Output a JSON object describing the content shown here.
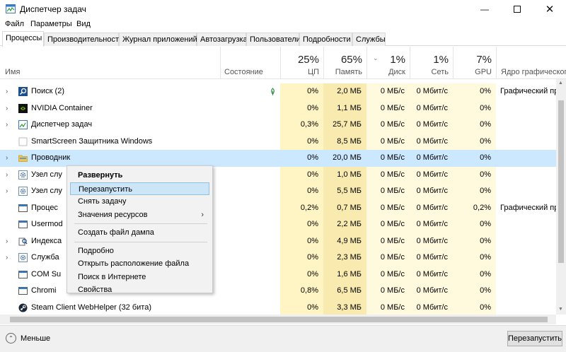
{
  "window": {
    "title": "Диспетчер задач",
    "min_icon": "minimize-icon",
    "max_icon": "maximize-icon",
    "close_icon": "close-icon"
  },
  "menu": [
    "Файл",
    "Параметры",
    "Вид"
  ],
  "tabs": [
    "Процессы",
    "Производительность",
    "Журнал приложений",
    "Автозагрузка",
    "Пользователи",
    "Подробности",
    "Службы"
  ],
  "active_tab": "Процессы",
  "columns": {
    "name": "Имя",
    "status": "Состояние",
    "cpu": {
      "pct": "25%",
      "label": "ЦП"
    },
    "mem": {
      "pct": "65%",
      "label": "Память"
    },
    "disk": {
      "pct": "1%",
      "label": "Диск"
    },
    "net": {
      "pct": "1%",
      "label": "Сеть"
    },
    "gpu": {
      "pct": "7%",
      "label": "GPU"
    },
    "gpu_engine": "Ядро графического"
  },
  "rows": [
    {
      "name": "Поиск (2)",
      "expand": true,
      "icon": "search-app-icon",
      "status_icon": "leaf-icon",
      "cpu": "0%",
      "mem": "2,0 МБ",
      "disk": "0 МБ/с",
      "net": "0 Мбит/с",
      "gpu": "0%",
      "gpu_engine": "Графический про"
    },
    {
      "name": "NVIDIA Container",
      "expand": true,
      "icon": "nvidia-icon",
      "cpu": "0%",
      "mem": "1,1 МБ",
      "disk": "0 МБ/с",
      "net": "0 Мбит/с",
      "gpu": "0%",
      "gpu_engine": ""
    },
    {
      "name": "Диспетчер задач",
      "expand": true,
      "icon": "task-manager-icon",
      "cpu": "0,3%",
      "mem": "25,7 МБ",
      "disk": "0 МБ/с",
      "net": "0 Мбит/с",
      "gpu": "0%",
      "gpu_engine": ""
    },
    {
      "name": "SmartScreen Защитника Windows",
      "expand": false,
      "icon": "smartscreen-icon",
      "cpu": "0%",
      "mem": "8,5 МБ",
      "disk": "0 МБ/с",
      "net": "0 Мбит/с",
      "gpu": "0%",
      "gpu_engine": ""
    },
    {
      "name": "Проводник",
      "expand": true,
      "icon": "folder-icon",
      "cpu": "0%",
      "mem": "20,0 МБ",
      "disk": "0 МБ/с",
      "net": "0 Мбит/с",
      "gpu": "0%",
      "gpu_engine": "",
      "selected": true
    },
    {
      "name": "Узел слу",
      "expand": true,
      "icon": "gear-icon",
      "cpu": "0%",
      "mem": "1,0 МБ",
      "disk": "0 МБ/с",
      "net": "0 Мбит/с",
      "gpu": "0%",
      "gpu_engine": ""
    },
    {
      "name": "Узел слу",
      "expand": true,
      "icon": "gear-icon",
      "cpu": "0%",
      "mem": "5,5 МБ",
      "disk": "0 МБ/с",
      "net": "0 Мбит/с",
      "gpu": "0%",
      "gpu_engine": ""
    },
    {
      "name": "Процес",
      "expand": false,
      "icon": "window-app-icon",
      "cpu": "0,2%",
      "mem": "0,7 МБ",
      "disk": "0 МБ/с",
      "net": "0 Мбит/с",
      "gpu": "0,2%",
      "gpu_engine": "Графический про"
    },
    {
      "name": "Usermod",
      "expand": false,
      "icon": "window-app-icon",
      "cpu": "0%",
      "mem": "2,2 МБ",
      "disk": "0 МБ/с",
      "net": "0 Мбит/с",
      "gpu": "0%",
      "gpu_engine": ""
    },
    {
      "name": "Индекса",
      "expand": true,
      "icon": "indexer-icon",
      "cpu": "0%",
      "mem": "4,9 МБ",
      "disk": "0 МБ/с",
      "net": "0 Мбит/с",
      "gpu": "0%",
      "gpu_engine": ""
    },
    {
      "name": "Служба",
      "expand": true,
      "icon": "gear-icon",
      "cpu": "0%",
      "mem": "2,3 МБ",
      "disk": "0 МБ/с",
      "net": "0 Мбит/с",
      "gpu": "0%",
      "gpu_engine": ""
    },
    {
      "name": "COM Su",
      "expand": false,
      "icon": "window-app-icon",
      "cpu": "0%",
      "mem": "1,6 МБ",
      "disk": "0 МБ/с",
      "net": "0 Мбит/с",
      "gpu": "0%",
      "gpu_engine": ""
    },
    {
      "name": "Chromi",
      "expand": false,
      "icon": "window-app-icon",
      "cpu": "0,8%",
      "mem": "6,5 МБ",
      "disk": "0 МБ/с",
      "net": "0 Мбит/с",
      "gpu": "0%",
      "gpu_engine": ""
    },
    {
      "name": "Steam Client WebHelper (32 бита)",
      "expand": false,
      "icon": "steam-icon",
      "cpu": "0%",
      "mem": "3,3 МБ",
      "disk": "0 МБ/с",
      "net": "0 Мбит/с",
      "gpu": "0%",
      "gpu_engine": ""
    }
  ],
  "context_menu": {
    "items": [
      {
        "label": "Развернуть",
        "bold": true
      },
      {
        "label": "Перезапустить",
        "hover": true
      },
      {
        "label": "Снять задачу"
      },
      {
        "label": "Значения ресурсов",
        "submenu": true
      },
      {
        "separator": true
      },
      {
        "label": "Создать файл дампа"
      },
      {
        "separator": true
      },
      {
        "label": "Подробно"
      },
      {
        "label": "Открыть расположение файла"
      },
      {
        "label": "Поиск в Интернете"
      },
      {
        "label": "Свойства"
      }
    ]
  },
  "footer": {
    "less_label": "Меньше",
    "restart_label": "Перезапустить"
  }
}
